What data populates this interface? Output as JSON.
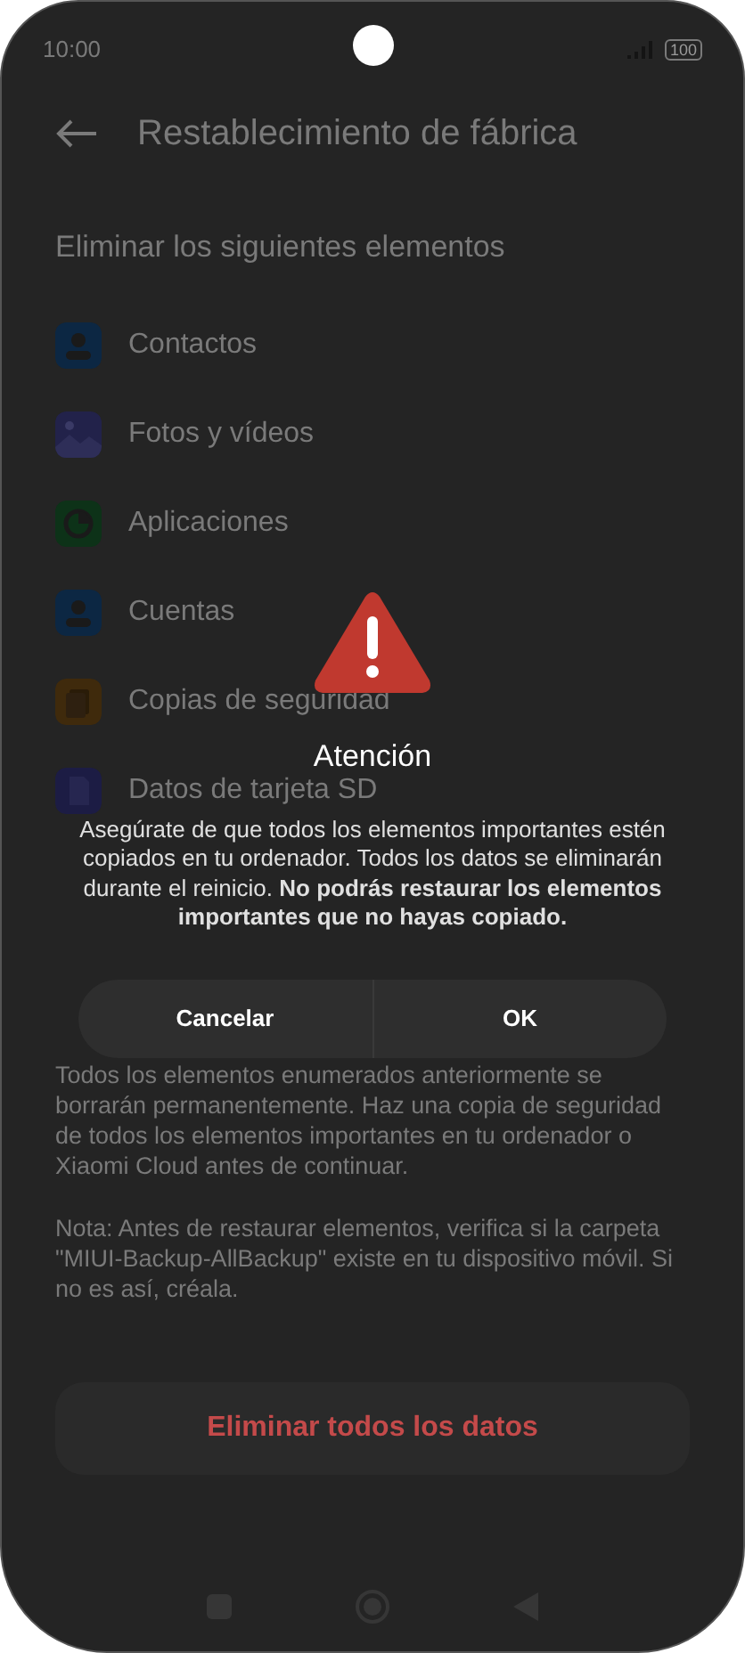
{
  "status_bar": {
    "time": "10:00",
    "battery": "100"
  },
  "header": {
    "title": "Restablecimiento de fábrica"
  },
  "section_title": "Eliminar los siguientes elementos",
  "items": [
    {
      "label": "Contactos",
      "kind": "contacts"
    },
    {
      "label": "Fotos y vídeos",
      "kind": "photos"
    },
    {
      "label": "Aplicaciones",
      "kind": "apps"
    },
    {
      "label": "Cuentas",
      "kind": "accounts"
    },
    {
      "label": "Copias de seguridad",
      "kind": "backup"
    },
    {
      "label": "Datos de tarjeta SD",
      "kind": "sd"
    }
  ],
  "paragraphs": [
    "Todos los elementos enumerados anteriormente se borrarán permanentemente. Haz una copia de seguridad de todos los elementos importantes en tu ordenador o Xiaomi Cloud antes de continuar.",
    "Nota: Antes de restaurar elementos, verifica si la carpeta \"MIUI-Backup-AllBackup\" existe en tu dispositivo móvil. Si no es así, créala."
  ],
  "delete_button": "Eliminar todos los datos",
  "dialog": {
    "title": "Atención",
    "message": "Asegúrate de que todos los elementos importantes estén copiados en tu ordenador. Todos los datos se eliminarán durante el reinicio. **No podrás restaurar los elementos importantes que no hayas copiado.**",
    "buttons": [
      "Cancelar",
      "OK"
    ]
  }
}
